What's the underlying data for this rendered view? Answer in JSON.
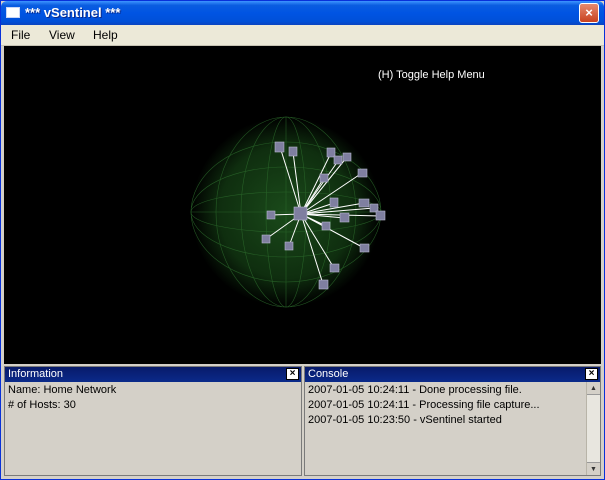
{
  "window": {
    "title": "*** vSentinel ***",
    "close_label": "×"
  },
  "menu": {
    "items": [
      "File",
      "View",
      "Help"
    ]
  },
  "canvas": {
    "help_hint": "(H) Toggle Help Menu"
  },
  "info_panel": {
    "title": "Information",
    "close_label": "×",
    "lines": [
      "Name: Home Network",
      "# of Hosts: 30"
    ]
  },
  "console_panel": {
    "title": "Console",
    "close_label": "×",
    "lines": [
      "2007-01-05 10:24:11 - Done processing file.",
      "2007-01-05 10:24:11 - Processing file capture...",
      "2007-01-05 10:23:50 - vSentinel started"
    ]
  },
  "colors": {
    "background": "#000000",
    "link": "#ffffff",
    "node": "#7f7fa0",
    "globe": "#1f5a1f"
  }
}
